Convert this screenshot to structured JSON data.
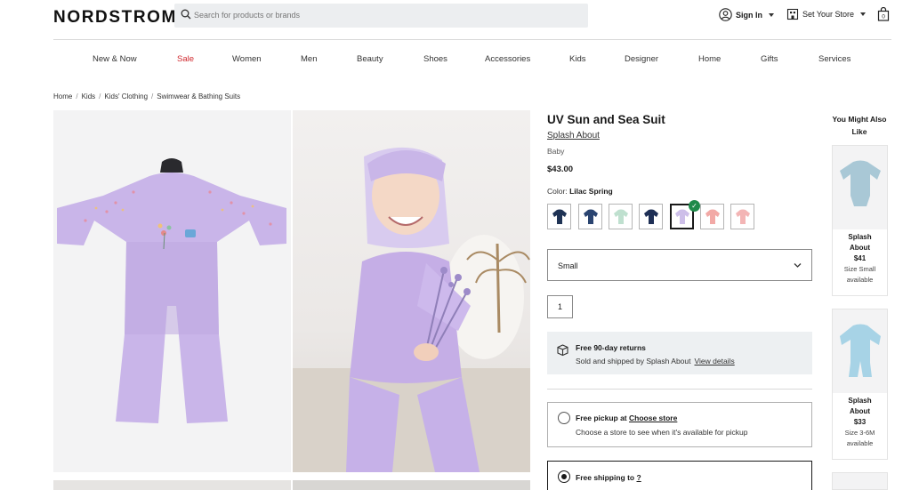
{
  "header": {
    "logo": "NORDSTROM",
    "search_placeholder": "Search for products or brands",
    "sign_in": "Sign In",
    "store": "Set Your Store"
  },
  "nav": [
    "New & Now",
    "Sale",
    "Women",
    "Men",
    "Beauty",
    "Shoes",
    "Accessories",
    "Kids",
    "Designer",
    "Home",
    "Gifts",
    "Services"
  ],
  "breadcrumbs": [
    "Home",
    "Kids",
    "Kids' Clothing",
    "Swimwear & Bathing Suits"
  ],
  "product": {
    "title": "UV Sun and Sea Suit",
    "brand": "Splash About",
    "age": "Baby",
    "price": "$43.00",
    "color_label": "Color:",
    "color_value": "Lilac Spring",
    "size": "Small",
    "quantity": "1"
  },
  "swatch_colors": [
    "#1f3355",
    "#2a4470",
    "#bfe0cf",
    "#1e2f55",
    "#cdbfe9",
    "#f2a9a6",
    "#f3b5b5"
  ],
  "returns": {
    "title": "Free 90-day returns",
    "detail": "Sold and shipped by Splash About",
    "link": "View details"
  },
  "pickup": {
    "title": "Free pickup at",
    "link": "Choose store",
    "detail": "Choose a store to see when it's available for pickup"
  },
  "shipping": {
    "title": "Free shipping to",
    "link": "?"
  },
  "recommend": {
    "heading": "You Might Also Like",
    "items": [
      {
        "name_1": "Splash",
        "name_2": "About",
        "price": "$41",
        "size": "Size Small",
        "avail": "available",
        "color": "#a9c8d6"
      },
      {
        "name_1": "Splash",
        "name_2": "About",
        "price": "$33",
        "size": "Size 3-6M",
        "avail": "available",
        "color": "#a7d3e6"
      }
    ]
  },
  "accent": {
    "sale": "#d0282e",
    "lilac": "#c6b2e6"
  }
}
